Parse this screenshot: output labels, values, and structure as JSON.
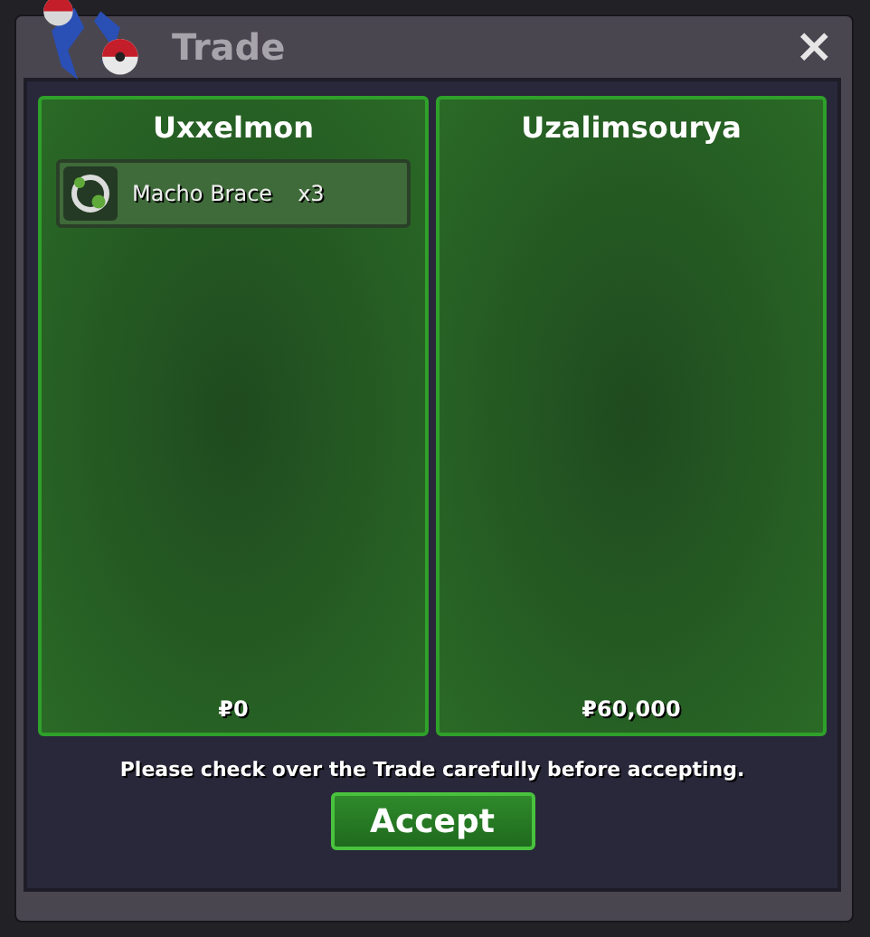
{
  "window": {
    "title": "Trade",
    "close": "×"
  },
  "traders": [
    {
      "name": "Uxxelmon",
      "items": [
        {
          "name": "Macho Brace",
          "quantity": "x3"
        }
      ],
      "money": "₽0"
    },
    {
      "name": "Uzalimsourya",
      "money": "₽60,000"
    }
  ],
  "message": "Please check over the Trade carefully before accepting.",
  "accept_button": "Accept"
}
